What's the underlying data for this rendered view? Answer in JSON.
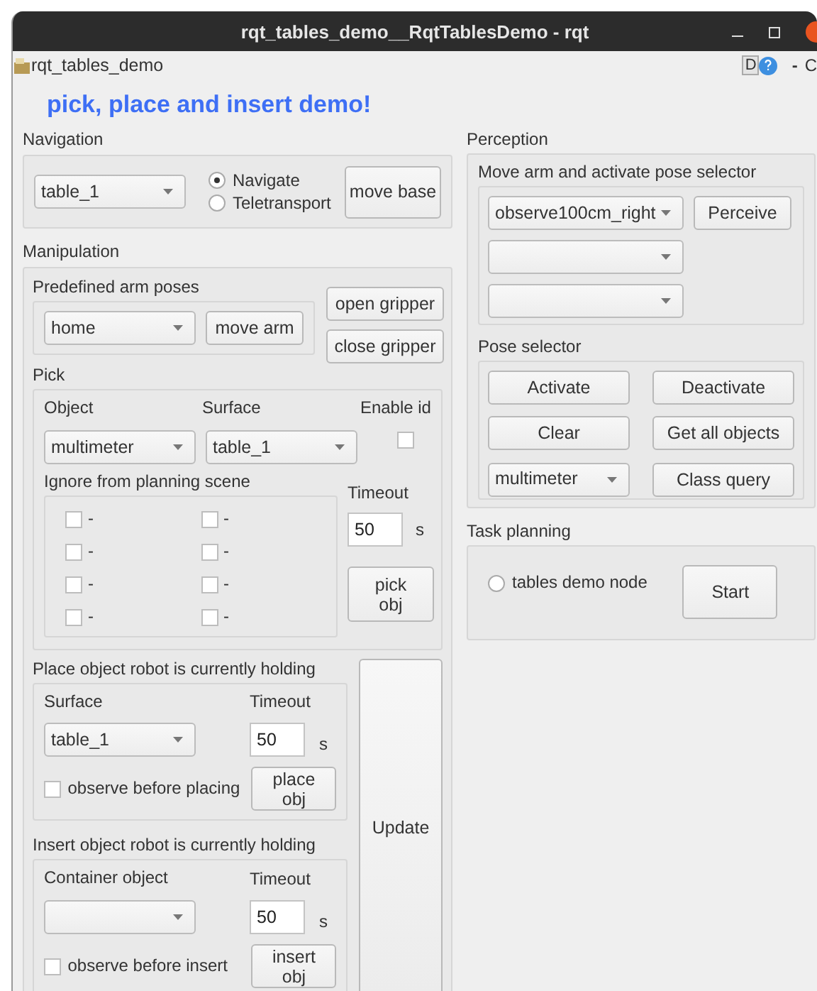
{
  "window": {
    "title": "rqt_tables_demo__RqtTablesDemo - rqt"
  },
  "plugin_bar": {
    "title": "rqt_tables_demo",
    "d_button": "D",
    "tail": [
      "-",
      "C"
    ]
  },
  "heading": "pick, place and insert demo!",
  "navigation": {
    "title": "Navigation",
    "target": "table_1",
    "modes": [
      {
        "label": "Navigate",
        "selected": true
      },
      {
        "label": "Teletransport",
        "selected": false
      }
    ],
    "button": "move base"
  },
  "manipulation": {
    "title": "Manipulation",
    "arm_poses": {
      "title": "Predefined arm poses",
      "pose": "home",
      "button": "move arm"
    },
    "gripper_buttons": [
      "open gripper",
      "close gripper"
    ],
    "pick": {
      "title": "Pick",
      "object_label": "Object",
      "object": "multimeter",
      "surface_label": "Surface",
      "surface": "table_1",
      "enable_id_label": "Enable id",
      "enable_id": false,
      "ignore_title": "Ignore from planning scene",
      "ignore_items": [
        {
          "label": "-",
          "checked": false
        },
        {
          "label": "-",
          "checked": false
        },
        {
          "label": "-",
          "checked": false
        },
        {
          "label": "-",
          "checked": false
        },
        {
          "label": "-",
          "checked": false
        },
        {
          "label": "-",
          "checked": false
        },
        {
          "label": "-",
          "checked": false
        },
        {
          "label": "-",
          "checked": false
        }
      ],
      "timeout_label": "Timeout",
      "timeout": "50",
      "unit": "s",
      "button": "pick obj"
    },
    "place": {
      "title": "Place object robot is currently holding",
      "field_label": "Surface",
      "value": "table_1",
      "timeout_label": "Timeout",
      "timeout": "50",
      "unit": "s",
      "observe_label": "observe before placing",
      "observe": false,
      "button": "place obj"
    },
    "insert": {
      "title": "Insert object robot is currently holding",
      "field_label": "Container object",
      "timeout_label": "Timeout",
      "timeout": "50",
      "unit": "s",
      "observe_label": "observe before insert",
      "observe": false,
      "button": "insert obj"
    },
    "update_button": "Update"
  },
  "perception": {
    "title": "Perception",
    "move_arm": {
      "title": "Move arm and activate pose selector",
      "pose": "observe100cm_right",
      "button": "Perceive"
    },
    "pose_selector": {
      "title": "Pose selector",
      "buttons": [
        "Activate",
        "Deactivate",
        "Clear",
        "Get all objects"
      ],
      "object": "multimeter",
      "query_button": "Class query"
    }
  },
  "task_planning": {
    "title": "Task planning",
    "node": {
      "label": "tables demo node",
      "selected": false
    },
    "button": "Start"
  }
}
